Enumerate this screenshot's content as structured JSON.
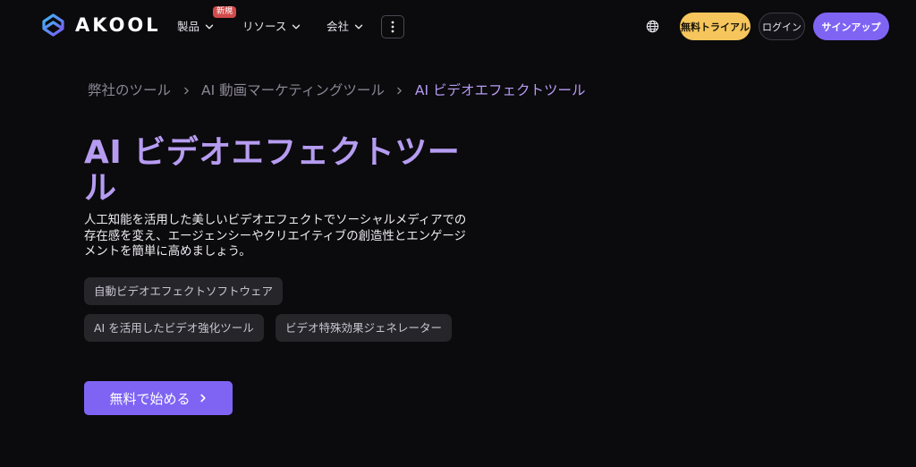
{
  "brand": {
    "name": "AKOOL"
  },
  "nav": {
    "items": [
      {
        "label": "製品",
        "icon": "chevron-down-icon"
      },
      {
        "label": "リソース",
        "icon": "chevron-down-icon"
      },
      {
        "label": "会社",
        "icon": "chevron-down-icon"
      }
    ],
    "badge_new": "新規",
    "more_icon": "more-vertical-icon"
  },
  "header_actions": {
    "language_icon": "globe-icon",
    "free_trial": "無料トライアル",
    "login": "ログイン",
    "signup": "サインアップ"
  },
  "breadcrumb": {
    "items": [
      "弊社のツール",
      "AI 動画マーケティングツール",
      "AI ビデオエフェクトツール"
    ],
    "separator_icon": "chevron-right-icon"
  },
  "hero": {
    "title": "AI ビデオエフェクトツール",
    "description": "人工知能を活用した美しいビデオエフェクトでソーシャルメディアでの存在感を変え、エージェンシーやクリエイティブの創造性とエンゲージメントを簡単に高めましょう。",
    "tags": [
      "自動ビデオエフェクトソフトウェア",
      "AI を活用したビデオ強化ツール",
      "ビデオ特殊効果ジェネレーター"
    ],
    "cta": "無料で始める"
  },
  "colors": {
    "background": "#0b0a0d",
    "accent": "#7f64f4",
    "title": "#b69cf1",
    "trial": "#f6c65c",
    "badge": "#d24b4b"
  }
}
